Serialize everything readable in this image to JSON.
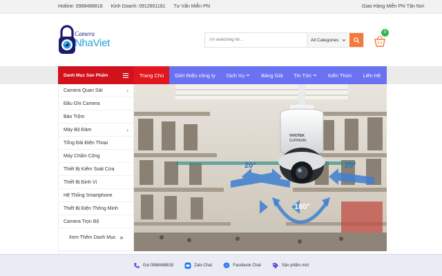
{
  "topbar": {
    "hotline": "Hotline: 0988488818",
    "sales": "Kinh Doanh: 0912861181",
    "consult": "Tư Vấn Miễn Phí",
    "shipping": "Giao Hàng Miễn Phí Tận Nơi"
  },
  "logo": {
    "top_word": "Camera",
    "brand": "NhaViet"
  },
  "search": {
    "placeholder": "I'm searching for...",
    "category": "All Categories"
  },
  "cart": {
    "count": "0"
  },
  "nav": {
    "category_label": "Danh Mục Sản Phẩm",
    "items": [
      "Trang Chủ",
      "Giới thiệu công ty",
      "Dịch Vụ",
      "Bảng Giá",
      "Tin Tức",
      "Kiến Thức",
      "Liên Hệ"
    ]
  },
  "sidebar": {
    "items": [
      "Camera Quan Sát",
      "Đầu Ghi Camera",
      "Báo Trộm",
      "Máy Bộ Đàm",
      "Tổng Đài Điện Thoại",
      "Máy Chấm Công",
      "Thiết Bị Kiểm Soát Cửa",
      "Thiết Bị Định Vị",
      "Hệ Thống Smartphone",
      "Thiết Bị Điện Thông Minh",
      "Camera Trọn Bộ"
    ],
    "more": "Xem Thêm Danh Mục"
  },
  "banner": {
    "angle_left": "20°",
    "angle_right": "20°",
    "angle_bottom": "180°",
    "camera_brand": "VIVOTEK",
    "camera_model": "SUPREME"
  },
  "bottombar": {
    "call": "Gọi 0988488818",
    "zalo": "Zalo Chat",
    "facebook": "Facebook Chat",
    "deals": "Sản phẩm mới"
  },
  "colors": {
    "accent_red": "#d1111b",
    "nav_blue": "#6a72f2",
    "search_orange": "#f4793b",
    "brand_blue": "#1fa3d9"
  }
}
